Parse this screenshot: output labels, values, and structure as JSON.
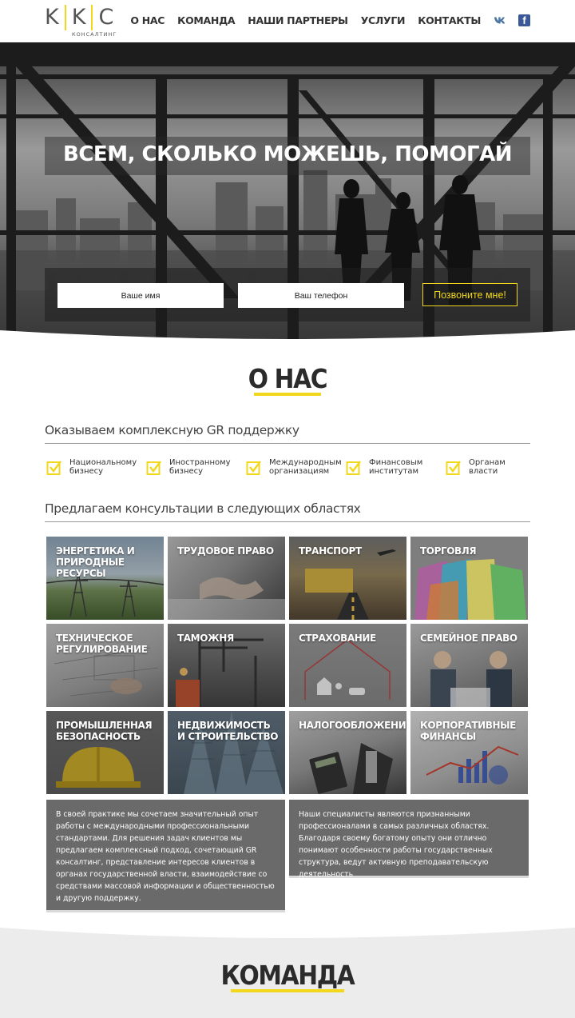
{
  "header": {
    "logo": {
      "letters": [
        "K",
        "K",
        "C"
      ],
      "subtitle": "КОНСАЛТИНГ",
      "accent": "#f2d81c"
    },
    "nav": [
      "О НАС",
      "КОМАНДА",
      "НАШИ ПАРТНЕРЫ",
      "УСЛУГИ",
      "КОНТАКТЫ"
    ],
    "social": [
      {
        "name": "vk-icon",
        "glyph": "vk"
      },
      {
        "name": "facebook-icon",
        "glyph": "f"
      }
    ]
  },
  "hero": {
    "title": "ВСЕМ, СКОЛЬКО МОЖЕШЬ, ПОМОГАЙ",
    "name_placeholder": "Ваше имя",
    "phone_placeholder": "Ваш телефон",
    "call_button": "Позвоните мне!"
  },
  "about": {
    "title": "О НАС",
    "support_heading": "Оказываем комплексную GR поддержку",
    "support_items": [
      [
        "Национальному",
        "бизнесу"
      ],
      [
        "Иностранному",
        "бизнесу"
      ],
      [
        "Международным",
        "организациям"
      ],
      [
        "Финансовым",
        "институтам"
      ],
      [
        "Органам",
        "власти"
      ]
    ],
    "consult_heading": "Предлагаем консультации в следующих областях",
    "areas": [
      "ЭНЕРГЕТИКА И ПРИРОДНЫЕ РЕСУРСЫ",
      "ТРУДОВОЕ ПРАВО",
      "ТРАНСПОРТ",
      "ТОРГОВЛЯ",
      "ТЕХНИЧЕСКОЕ РЕГУЛИРОВАНИЕ",
      "ТАМОЖНЯ",
      "СТРАХОВАНИЕ",
      "СЕМЕЙНОЕ ПРАВО",
      "ПРОМЫШЛЕННАЯ БЕЗОПАСНОСТЬ",
      "НЕДВИЖИМОСТЬ И СТРОИТЕЛЬСТВО",
      "НАЛОГООБЛОЖЕНИЕ",
      "КОРПОРАТИВНЫЕ ФИНАНСЫ"
    ],
    "text_left": "В своей практике мы сочетаем значительный опыт работы с международными профессиональными стандартами. Для решения задач клиентов мы предлагаем комплексный подход, сочетающий GR консалтинг, представление интересов клиентов в органах государственной власти, взаимодействие со средствами массовой информации и общественностью и другую поддержку.",
    "text_right": "Наши специалисты являются признанными профессионалами в самых различных областях. Благодаря своему богатому опыту они отлично понимают особенности работы государственных структура, ведут активную преподавательскую деятельность"
  },
  "team": {
    "title": "КОМАНДА"
  }
}
